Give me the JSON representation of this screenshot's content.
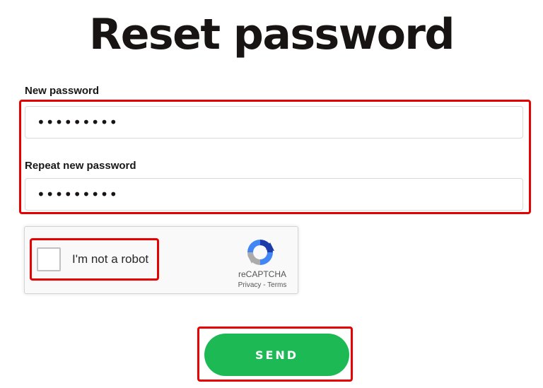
{
  "page": {
    "title": "Reset password"
  },
  "form": {
    "new_password": {
      "label": "New password",
      "value": "•••••••••"
    },
    "repeat_password": {
      "label": "Repeat new password",
      "value": "•••••••••"
    }
  },
  "recaptcha": {
    "checkbox_label": "I'm not a robot",
    "brand": "reCAPTCHA",
    "privacy_link": "Privacy",
    "separator": " - ",
    "terms_link": "Terms",
    "checked": false
  },
  "actions": {
    "send_label": "SEND"
  },
  "colors": {
    "accent": "#1db954",
    "highlight": "#e60000",
    "title": "#191414"
  },
  "icons": {
    "recaptcha_logo": "recaptcha-logo-icon"
  }
}
